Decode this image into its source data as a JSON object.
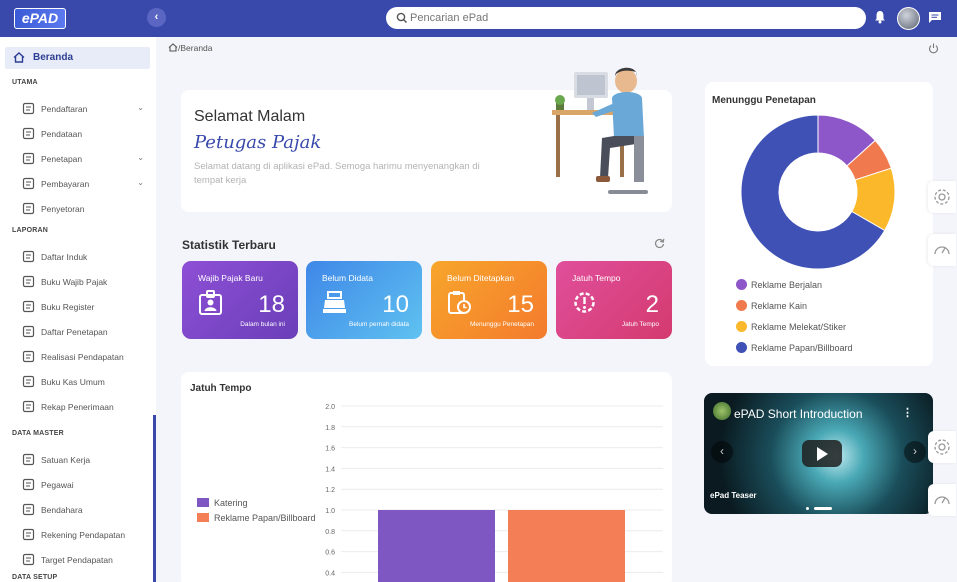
{
  "app": {
    "logo": "ePAD"
  },
  "search": {
    "placeholder": "Pencarian ePad"
  },
  "sidebar": {
    "active": {
      "label": "Beranda"
    },
    "sections": [
      {
        "title": "UTAMA",
        "items": [
          {
            "label": "Pendaftaran",
            "icon": "register-icon",
            "expandable": true
          },
          {
            "label": "Pendataan",
            "icon": "data-icon",
            "expandable": false
          },
          {
            "label": "Penetapan",
            "icon": "stamp-icon",
            "expandable": true
          },
          {
            "label": "Pembayaran",
            "icon": "payment-icon",
            "expandable": true
          },
          {
            "label": "Penyetoran",
            "icon": "bank-icon",
            "expandable": false
          }
        ]
      },
      {
        "title": "LAPORAN",
        "items": [
          {
            "label": "Daftar Induk",
            "icon": "book-icon"
          },
          {
            "label": "Buku Wajib Pajak",
            "icon": "id-card-icon"
          },
          {
            "label": "Buku Register",
            "icon": "register-book-icon"
          },
          {
            "label": "Daftar Penetapan",
            "icon": "checklist-icon"
          },
          {
            "label": "Realisasi Pendapatan",
            "icon": "receipt-icon"
          },
          {
            "label": "Buku Kas Umum",
            "icon": "open-book-icon"
          },
          {
            "label": "Rekap Penerimaan",
            "icon": "report-icon"
          }
        ]
      },
      {
        "title": "DATA MASTER",
        "items": [
          {
            "label": "Satuan Kerja",
            "icon": "org-chart-icon"
          },
          {
            "label": "Pegawai",
            "icon": "users-icon"
          },
          {
            "label": "Bendahara",
            "icon": "user-circle-icon"
          },
          {
            "label": "Rekening Pendapatan",
            "icon": "card-icon"
          },
          {
            "label": "Target Pendapatan",
            "icon": "target-icon"
          }
        ]
      },
      {
        "title": "DATA SETUP",
        "items": []
      }
    ]
  },
  "breadcrumb": "/Beranda",
  "welcome": {
    "greeting": "Selamat Malam",
    "name": "Petugas Pajak",
    "description": "Selamat datang di aplikasi ePad. Semoga harimu menyenangkan di tempat kerja"
  },
  "stats": {
    "title": "Statistik Terbaru",
    "cards": [
      {
        "title": "Wajib Pajak Baru",
        "value": "18",
        "subtitle": "Dalam bulan ini",
        "icon": "id-badge-icon",
        "color": "#7e47c9"
      },
      {
        "title": "Belum Didata",
        "value": "10",
        "subtitle": "Belum pernah didata",
        "icon": "cash-register-icon",
        "color": "#4aa3ec"
      },
      {
        "title": "Belum Ditetapkan",
        "value": "15",
        "subtitle": "Menunggu Penetapan",
        "icon": "clipboard-clock-icon",
        "color": "#f5902c"
      },
      {
        "title": "Jatuh Tempo",
        "value": "2",
        "subtitle": "Jatuh Tempo",
        "icon": "alert-gear-icon",
        "color": "#dc4585"
      }
    ]
  },
  "jatuh_tempo": {
    "title": "Jatuh Tempo",
    "chart_data": {
      "type": "bar",
      "categories": [
        "Katering",
        "Reklame Papan/Billboard"
      ],
      "series": [
        {
          "name": "Katering",
          "values": [
            1.0
          ],
          "color": "#7e57c2"
        },
        {
          "name": "Reklame Papan/Billboard",
          "values": [
            1.0
          ],
          "color": "#f47f56"
        }
      ],
      "ylim": [
        0,
        2.0
      ],
      "yticks": [
        "2.0",
        "1.8",
        "1.6",
        "1.4",
        "1.2",
        "1.0",
        "0.8",
        "0.6",
        "0.4"
      ],
      "legend": "left",
      "grid": true
    }
  },
  "menunggu": {
    "title": "Menunggu Penetapan",
    "chart_data": {
      "type": "pie",
      "slices": [
        {
          "label": "Reklame Berjalan",
          "value": 2,
          "color": "#8e57c9"
        },
        {
          "label": "Reklame Kain",
          "value": 1,
          "color": "#f07a4e"
        },
        {
          "label": "Reklame Melekat/Stiker",
          "value": 2,
          "color": "#fbb82b"
        },
        {
          "label": "Reklame Papan/Billboard",
          "value": 10,
          "color": "#3f51b5"
        }
      ],
      "legend": "bottom"
    }
  },
  "video": {
    "title": "ePAD Short Introduction",
    "caption": "ePad Teaser"
  }
}
